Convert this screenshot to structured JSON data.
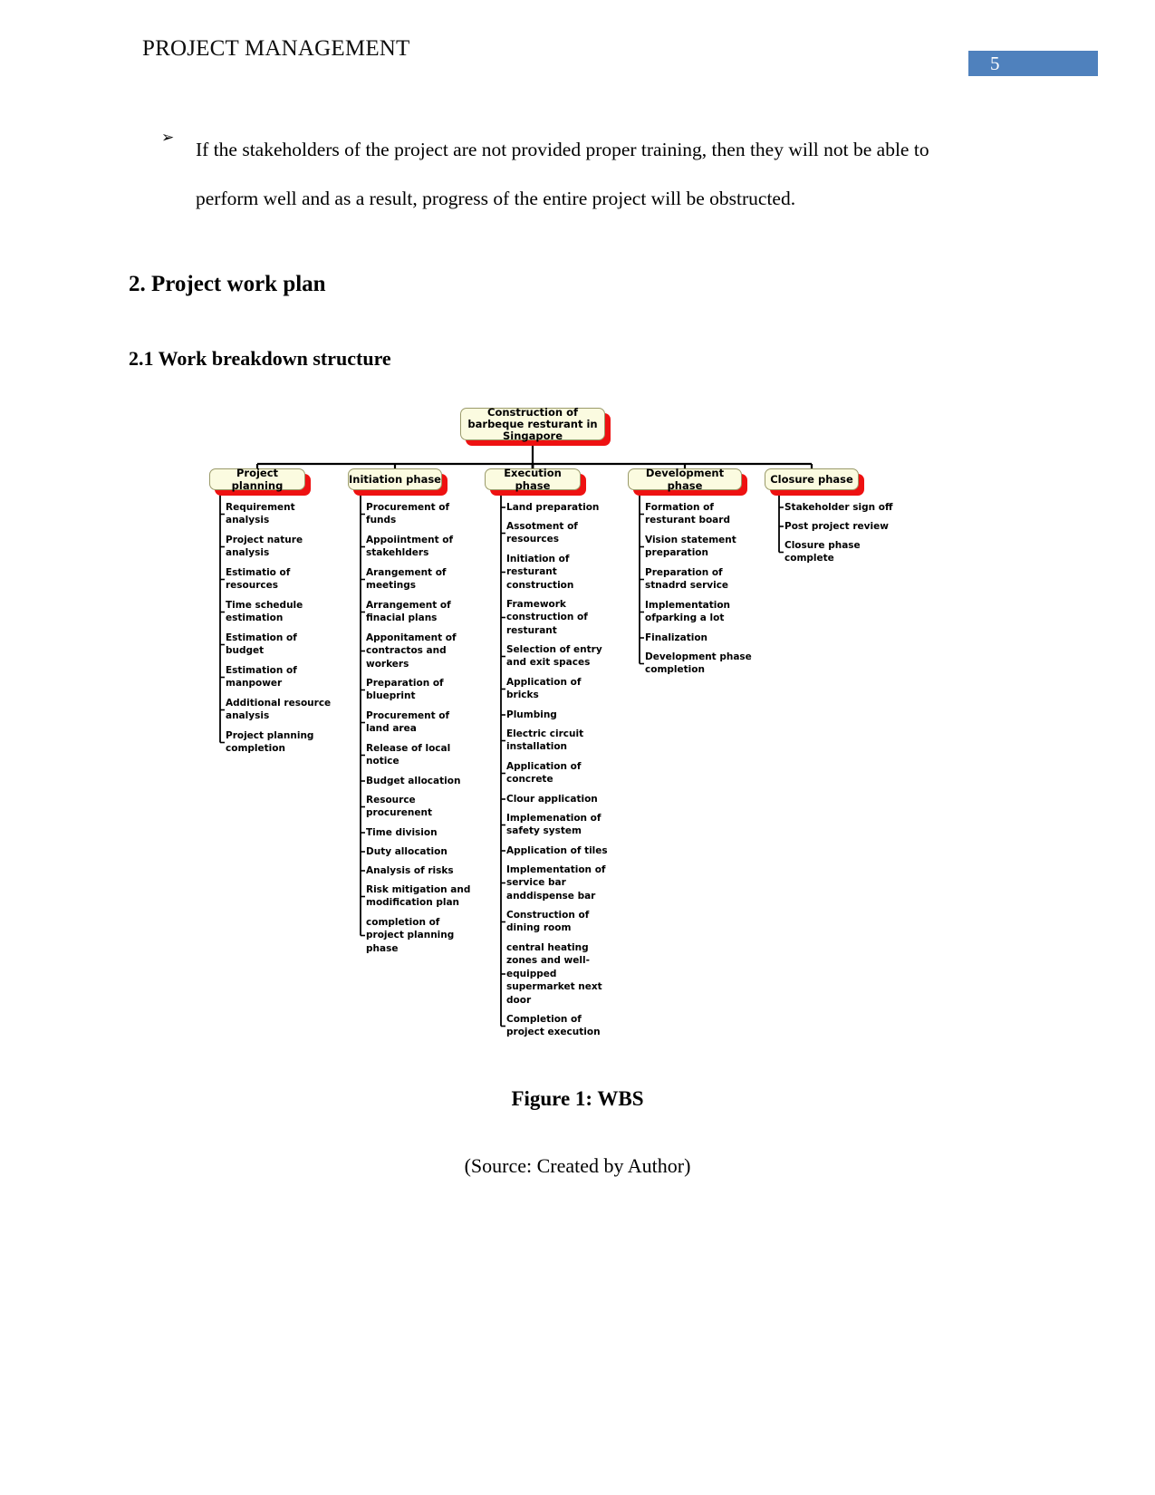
{
  "header": {
    "title": "PROJECT MANAGEMENT",
    "page_number": "5",
    "accent_color": "#4f81bd"
  },
  "body": {
    "bullet_marker": "➢",
    "bullet_text": "If the stakeholders of the project are not provided proper training, then they will not be able to perform well and as a result, progress of the entire project will be obstructed.",
    "heading_1": "2. Project work plan",
    "heading_2": "2.1 Work breakdown structure"
  },
  "figure": {
    "caption": "Figure 1: WBS",
    "source": "(Source: Created by Author)"
  },
  "wbs": {
    "node_fill": "#fbfbe0",
    "node_shadow": "#ee1111",
    "root": "Construction of barbeque resturant in Singapore",
    "branches": [
      {
        "title": "Project planning",
        "items": [
          "Requirement analysis",
          "Project nature analysis",
          "Estimatio of resources",
          "Time schedule estimation",
          "Estimation of budget",
          "Estimation of manpower",
          "Additional resource analysis",
          "Project planning completion"
        ]
      },
      {
        "title": "Initiation phase",
        "items": [
          "Procurement of funds",
          "Appoiintment of stakehlders",
          "Arangement of meetings",
          "Arrangement of finacial plans",
          "Apponitament of contractos and workers",
          "Preparation of blueprint",
          "Procurement of land area",
          "Release of local notice",
          "Budget allocation",
          "Resource procurenent",
          "Time division",
          "Duty allocation",
          "Analysis of risks",
          "Risk mitigation and modification plan",
          "completion of project planning phase"
        ]
      },
      {
        "title": "Execution phase",
        "items": [
          "Land preparation",
          "Assotment of resources",
          "Initiation of resturant construction",
          "Framework construction of resturant",
          "Selection of entry and exit spaces",
          "Application of bricks",
          "Plumbing",
          "Electric circuit installation",
          "Application of concrete",
          "Clour application",
          "Implemenation of safety system",
          "Application of tiles",
          "Implementation of service bar anddispense bar",
          "Construction of dining room",
          "central heating zones and well-equipped supermarket next door",
          "Completion of project execution"
        ]
      },
      {
        "title": "Development phase",
        "items": [
          "Formation of resturant board",
          "Vision statement preparation",
          "Preparation of stnadrd service",
          "Implementation ofparking a lot",
          "Finalization",
          "Development phase completion"
        ]
      },
      {
        "title": "Closure phase",
        "items": [
          "Stakeholder sign off",
          "Post project review",
          "Closure phase complete"
        ]
      }
    ]
  }
}
